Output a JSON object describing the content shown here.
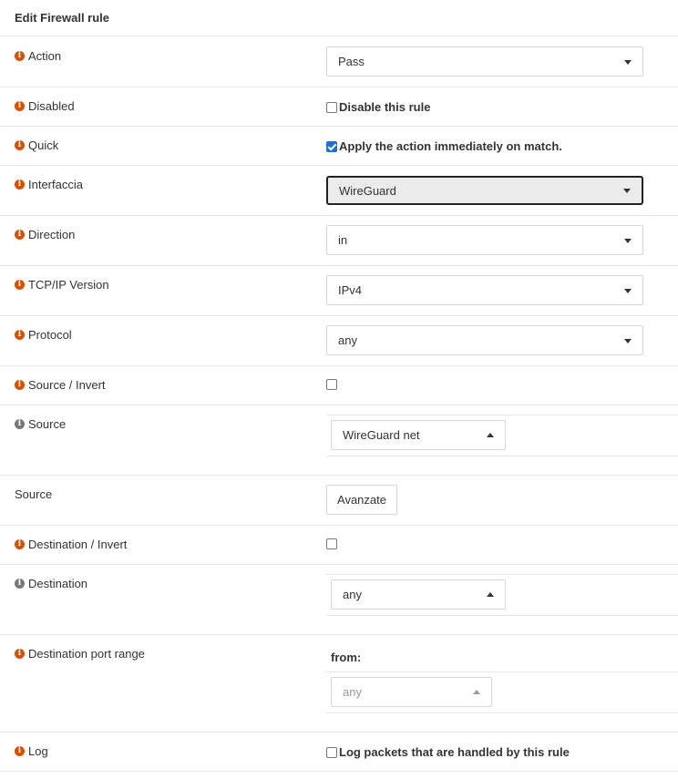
{
  "header": {
    "title": "Edit Firewall rule"
  },
  "fields": {
    "action": {
      "label": "Action",
      "value": "Pass"
    },
    "disabled": {
      "label": "Disabled",
      "checkbox_label": "Disable this rule",
      "checked": false
    },
    "quick": {
      "label": "Quick",
      "checkbox_label": "Apply the action immediately on match.",
      "checked": true
    },
    "interface": {
      "label": "Interfaccia",
      "value": "WireGuard"
    },
    "direction": {
      "label": "Direction",
      "value": "in"
    },
    "ip_version": {
      "label": "TCP/IP Version",
      "value": "IPv4"
    },
    "protocol": {
      "label": "Protocol",
      "value": "any"
    },
    "source_invert": {
      "label": "Source / Invert",
      "checked": false
    },
    "source": {
      "label": "Source",
      "value": "WireGuard net"
    },
    "source_advanced": {
      "label": "Source",
      "button_label": "Avanzate"
    },
    "destination_invert": {
      "label": "Destination / Invert",
      "checked": false
    },
    "destination": {
      "label": "Destination",
      "value": "any"
    },
    "dest_port_range": {
      "label": "Destination port range",
      "from_label": "from:",
      "from_value": "any"
    },
    "log": {
      "label": "Log",
      "checkbox_label": "Log packets that are handled by this rule",
      "checked": false
    }
  },
  "icons": {
    "info": "info-circle-icon",
    "caret_down": "caret-down-icon",
    "caret_up": "caret-up-icon"
  },
  "colors": {
    "info_icon": "#d94f00",
    "checkbox_checked": "#1e6fd9"
  }
}
